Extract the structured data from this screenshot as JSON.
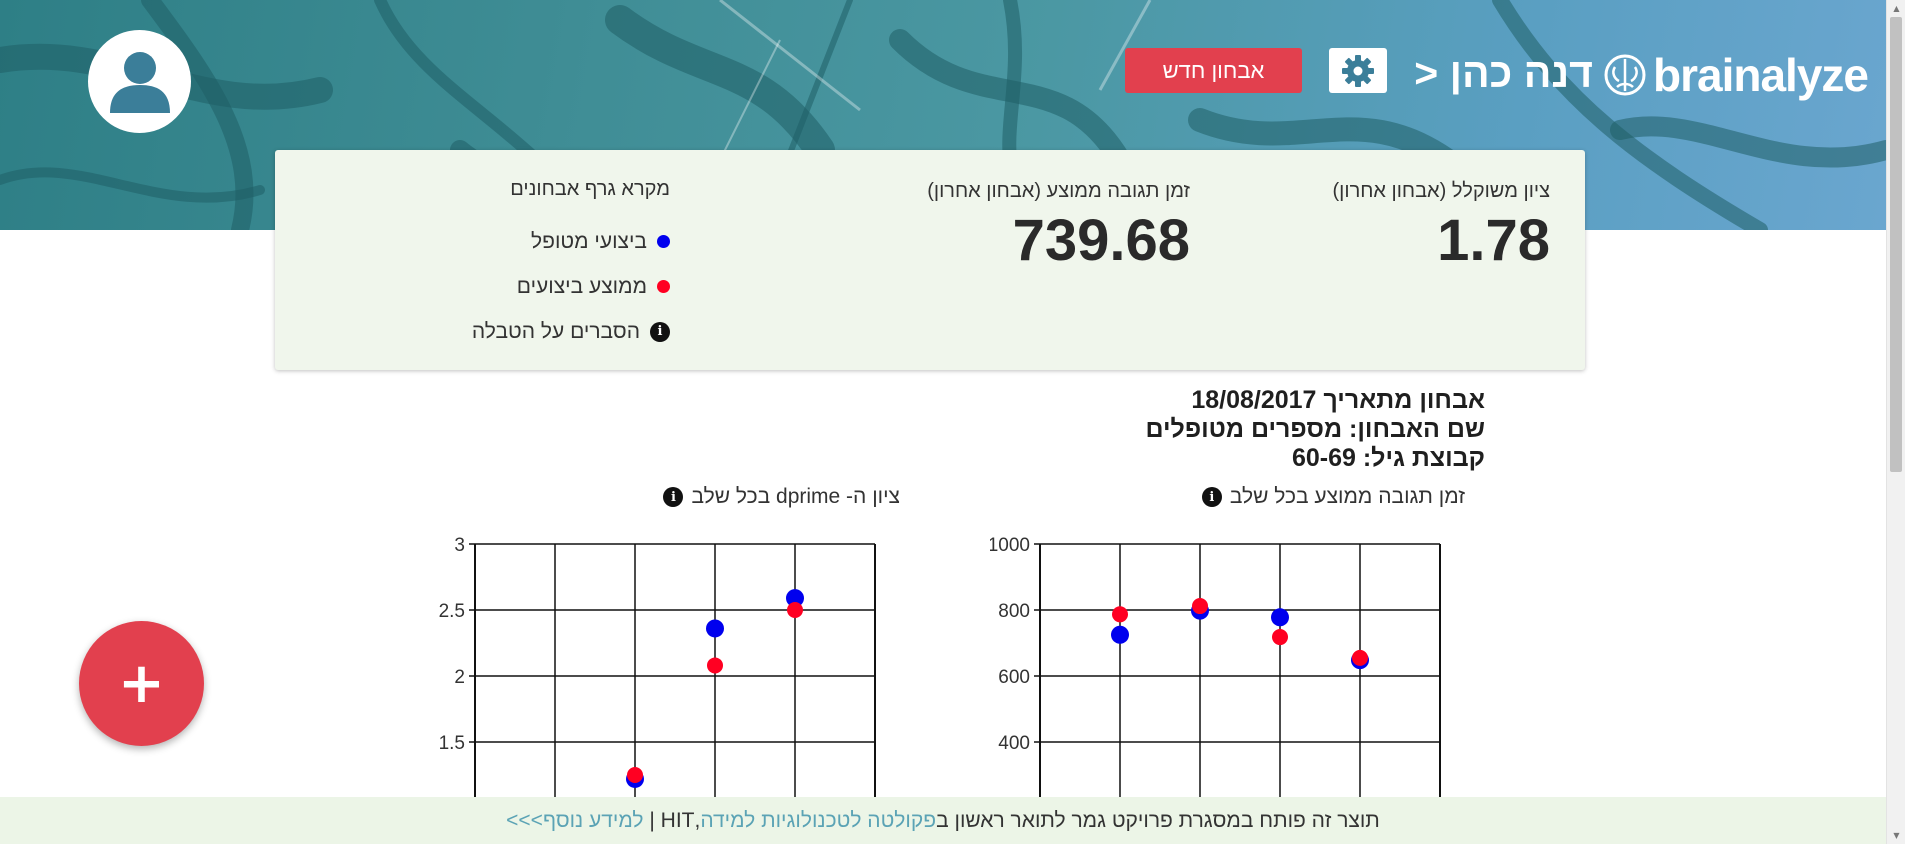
{
  "header": {
    "logo_text": "brainalyze",
    "breadcrumb": "דנה כהן <",
    "new_exam_button": "אבחון חדש",
    "icons": {
      "avatar": "user-icon",
      "settings": "gear-icon",
      "logo": "brain-icon"
    }
  },
  "summary": {
    "weighted_score_label": "ציון משוקלל (אבחון אחרון)",
    "weighted_score_value": "1.78",
    "avg_response_label": "זמן תגובה ממוצע (אבחון אחרון)",
    "avg_response_value": "739.68",
    "legend": {
      "title": "מקרא גרף אבחונים",
      "patient_label": "ביצועי מטופל",
      "average_label": "ממוצע ביצועים",
      "explain_label": "הסברים על הטבלה"
    }
  },
  "exam": {
    "date_line": "אבחון מתאריך 18/08/2017",
    "name_line": "שם האבחון: מספרים מטופלים",
    "age_line": "קבוצת גיל: 60-69"
  },
  "colors": {
    "patient": "#0000ee",
    "average": "#ff0022",
    "accent": "#e2404e",
    "card_bg": "#f0f6ec"
  },
  "chart_data": [
    {
      "type": "scatter",
      "title": "ציון ה- dprime בכל שלב",
      "ylim": [
        1.5,
        3
      ],
      "yticks": [
        "3",
        "2.5",
        "2",
        "1.5"
      ],
      "grid": true,
      "series": [
        {
          "name": "ביצועי מטופל",
          "points": [
            [
              2,
              1.22
            ],
            [
              3,
              2.36
            ],
            [
              4,
              2.59
            ]
          ]
        },
        {
          "name": "ממוצע ביצועים",
          "points": [
            [
              2,
              1.25
            ],
            [
              3,
              2.08
            ],
            [
              4,
              2.5
            ]
          ]
        }
      ]
    },
    {
      "type": "scatter",
      "title": "זמן תגובה ממוצע בכל שלב",
      "ylim": [
        400,
        1000
      ],
      "yticks": [
        "1000",
        "800",
        "600",
        "400"
      ],
      "grid": true,
      "series": [
        {
          "name": "ביצועי מטופל",
          "points": [
            [
              1,
              725
            ],
            [
              2,
              798
            ],
            [
              3,
              778
            ],
            [
              4,
              648
            ]
          ]
        },
        {
          "name": "ממוצע ביצועים",
          "points": [
            [
              1,
              787
            ],
            [
              2,
              812
            ],
            [
              3,
              718
            ],
            [
              4,
              655
            ]
          ]
        }
      ]
    }
  ],
  "fab": {
    "label": "+"
  },
  "footer": {
    "text": "תוצר זה פותח במסגרת פרויקט גמר לתואר ראשון ב",
    "faculty_link": "פקולטה לטכנולוגיות למידה",
    "institution": ",HIT",
    "separator": "|",
    "more_link": "למידע נוסף>>>"
  }
}
